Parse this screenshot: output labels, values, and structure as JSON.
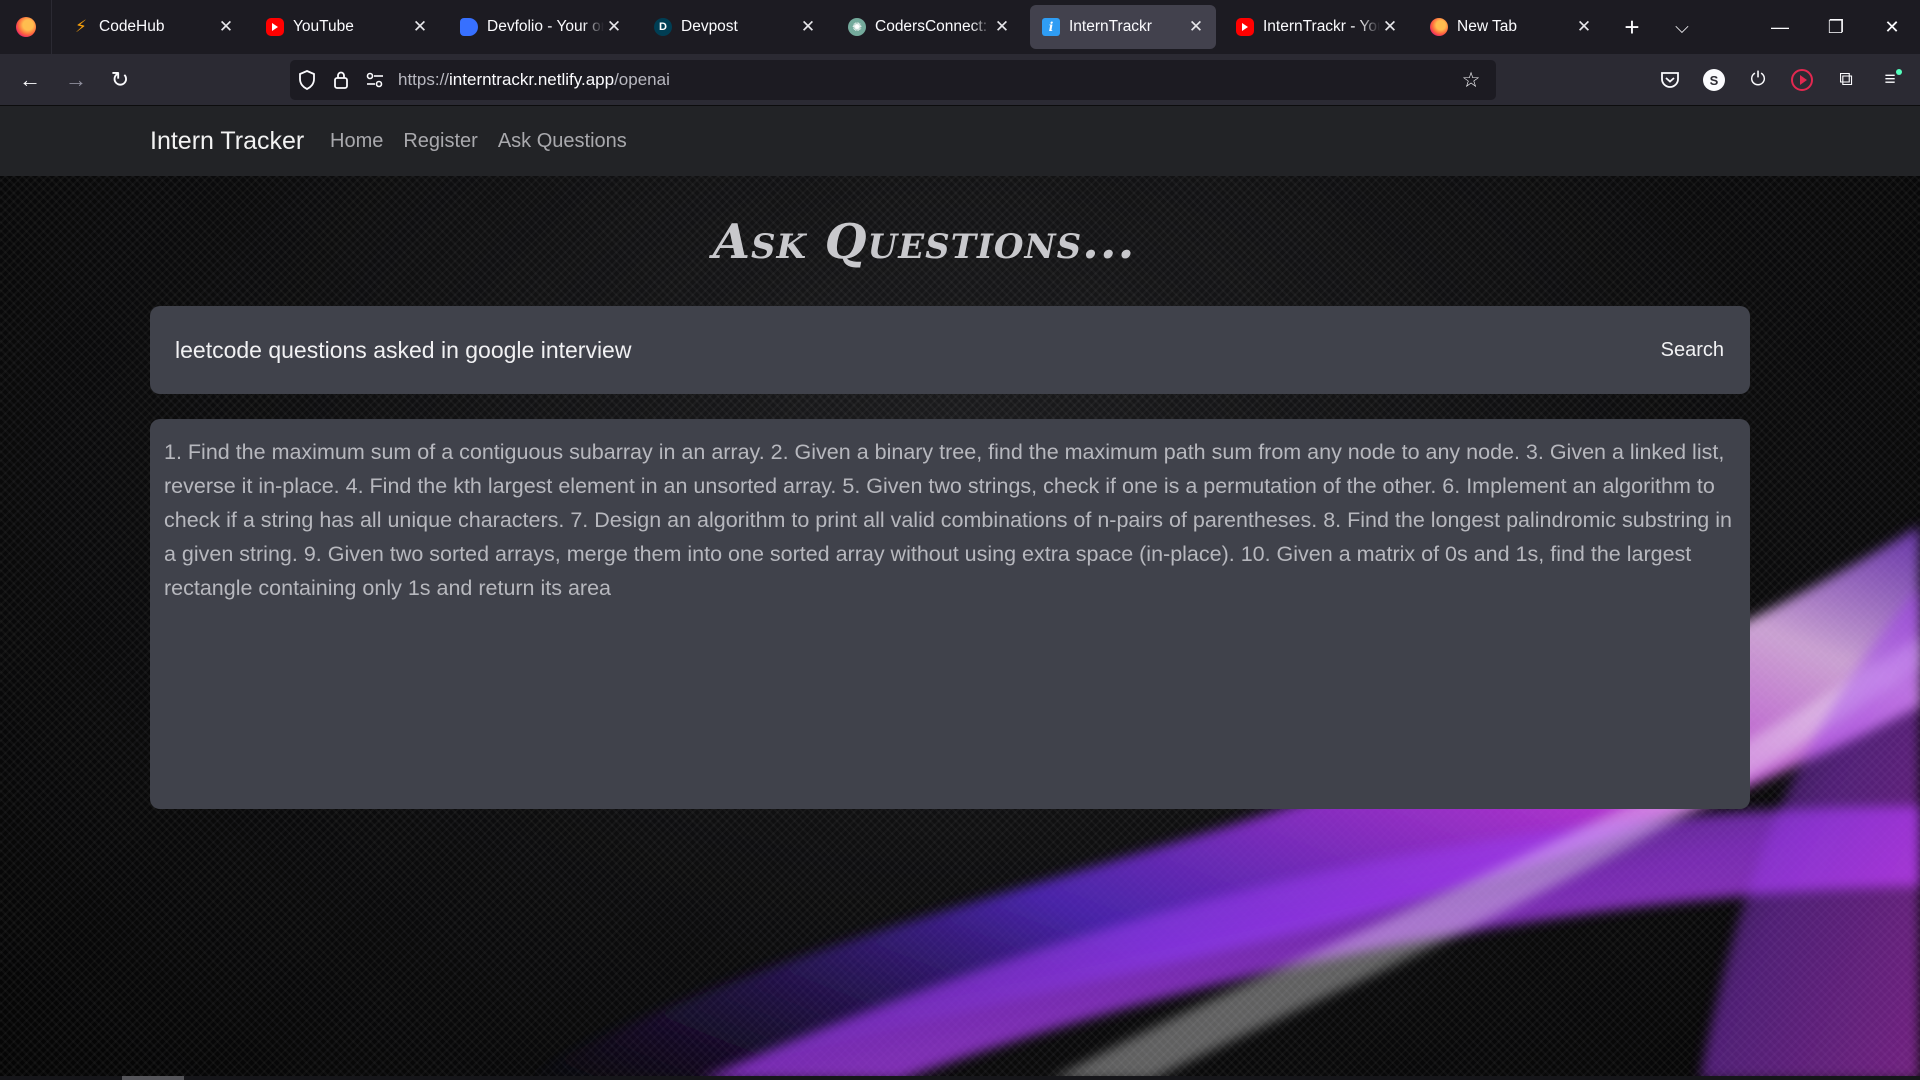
{
  "browser": {
    "tabs": [
      {
        "title": "CodeHub",
        "favicon": "codehub-icon",
        "active": false
      },
      {
        "title": "YouTube",
        "favicon": "youtube-icon",
        "active": false
      },
      {
        "title": "Devfolio - Your one",
        "favicon": "devfolio-icon",
        "active": false
      },
      {
        "title": "Devpost",
        "favicon": "devpost-icon",
        "active": false
      },
      {
        "title": "CodersConnect: In",
        "favicon": "openai-icon",
        "active": false
      },
      {
        "title": "InternTrackr",
        "favicon": "interntrackr-icon",
        "active": true
      },
      {
        "title": "InternTrackr - YouTube",
        "favicon": "youtube-icon",
        "active": false
      },
      {
        "title": "New Tab",
        "favicon": "firefox-icon",
        "active": false
      }
    ],
    "url": {
      "scheme": "https://",
      "host": "interntrackr.netlify.app",
      "path": "/openai"
    },
    "profile_initial": "S"
  },
  "site": {
    "brand": "Intern Tracker",
    "nav": [
      "Home",
      "Register",
      "Ask Questions"
    ]
  },
  "page": {
    "heading": "Ask Questions...",
    "search": {
      "value": "leetcode questions asked in google interview",
      "button": "Search"
    },
    "answer": "1. Find the maximum sum of a contiguous subarray in an array. 2. Given a binary tree, find the maximum path sum from any node to any node. 3. Given a linked list, reverse it in-place. 4. Find the kth largest element in an unsorted array. 5. Given two strings, check if one is a permutation of the other. 6. Implement an algorithm to check if a string has all unique characters. 7. Design an algorithm to print all valid combinations of n-pairs of parentheses. 8. Find the longest palindromic substring in a given string. 9. Given two sorted arrays, merge them into one sorted array without using extra space (in-place). 10. Given a matrix of 0s and 1s, find the largest rectangle containing only 1s and return its area"
  },
  "colors": {
    "page_background": "#000000",
    "card": "#40424b",
    "site_nav": "#222326",
    "swoosh_pink": "#e040fb",
    "swoosh_purple": "#7c3aed"
  }
}
